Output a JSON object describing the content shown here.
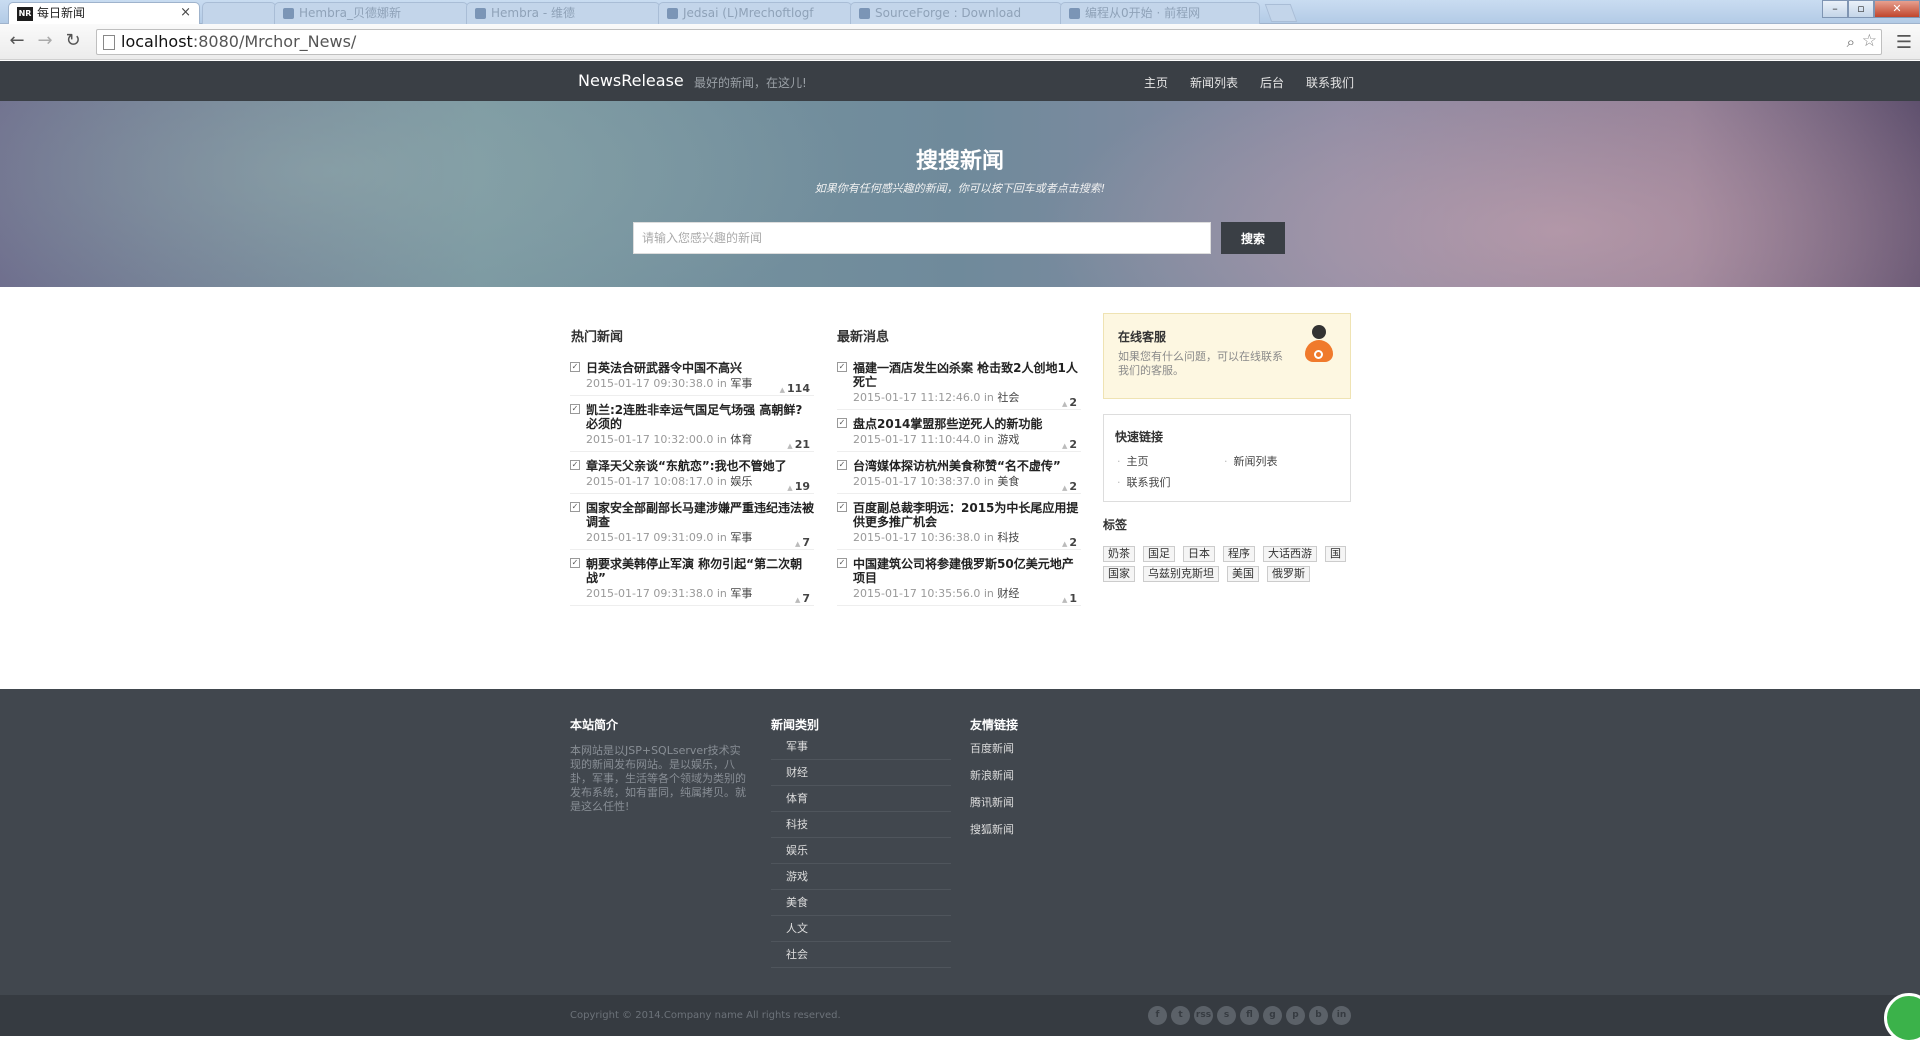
{
  "browser": {
    "active_tab": {
      "favicon": "NR",
      "title": "每日新闻"
    },
    "background_tabs": [
      "",
      "Hembra_贝德娜新",
      "Hembra - 维德",
      "Jedsai (L)Mrechoftlogf",
      "SourceForge : Download",
      "编程从0开始 · 前程网"
    ],
    "url_host": "localhost",
    "url_rest": ":8080/Mrchor_News/"
  },
  "nav": {
    "brand": "NewsRelease",
    "tagline": "最好的新闻，在这儿!",
    "links": [
      "主页",
      "新闻列表",
      "后台",
      "联系我们"
    ]
  },
  "hero": {
    "title": "搜搜新闻",
    "subtitle": "如果你有任何感兴趣的新闻，你可以按下回车或者点击搜索!",
    "search_placeholder": "请输入您感兴趣的新闻",
    "search_button": "搜索"
  },
  "hot": {
    "title": "热门新闻",
    "items": [
      {
        "title": "日英法合研武器令中国不高兴",
        "time": "2015-01-17 09:30:38.0",
        "in": "in",
        "category": "军事",
        "count": "114"
      },
      {
        "title": "凯兰:2连胜非幸运气国足气场强 高朝鲜?必须的",
        "time": "2015-01-17 10:32:00.0",
        "in": "in",
        "category": "体育",
        "count": "21"
      },
      {
        "title": "章泽天父亲谈“东航恋”:我也不管她了",
        "time": "2015-01-17 10:08:17.0",
        "in": "in",
        "category": "娱乐",
        "count": "19"
      },
      {
        "title": "国家安全部副部长马建涉嫌严重违纪违法被调查",
        "time": "2015-01-17 09:31:09.0",
        "in": "in",
        "category": "军事",
        "count": "7"
      },
      {
        "title": "朝要求美韩停止军演 称勿引起“第二次朝战”",
        "time": "2015-01-17 09:31:38.0",
        "in": "in",
        "category": "军事",
        "count": "7"
      }
    ]
  },
  "latest": {
    "title": "最新消息",
    "items": [
      {
        "title": "福建一酒店发生凶杀案 枪击致2人创地1人死亡",
        "time": "2015-01-17 11:12:46.0",
        "in": "in",
        "category": "社会",
        "count": "2"
      },
      {
        "title": "盘点2014掌盟那些逆死人的新功能",
        "time": "2015-01-17 11:10:44.0",
        "in": "in",
        "category": "游戏",
        "count": "2"
      },
      {
        "title": "台湾媒体探访杭州美食称赞“名不虚传”",
        "time": "2015-01-17 10:38:37.0",
        "in": "in",
        "category": "美食",
        "count": "2"
      },
      {
        "title": "百度副总裁李明远：2015为中长尾应用提供更多推广机会",
        "time": "2015-01-17 10:36:38.0",
        "in": "in",
        "category": "科技",
        "count": "2"
      },
      {
        "title": "中国建筑公司将参建俄罗斯50亿美元地产项目",
        "time": "2015-01-17 10:35:56.0",
        "in": "in",
        "category": "财经",
        "count": "1"
      }
    ]
  },
  "sidebar": {
    "service_title": "在线客服",
    "service_desc": "如果您有什么问题，可以在线联系我们的客服。",
    "quick_title": "快速链接",
    "quick_links": [
      "主页",
      "新闻列表",
      "联系我们"
    ],
    "tags_title": "标签",
    "tags": [
      "奶茶",
      "国足",
      "日本",
      "程序",
      "大话西游",
      "国",
      "国家",
      "乌兹别克斯坦",
      "美国",
      "俄罗斯"
    ]
  },
  "footer": {
    "about_title": "本站简介",
    "about_text": "本网站是以JSP+SQLserver技术实现的新闻发布网站。是以娱乐，八卦，军事，生活等各个领域为类别的发布系统，如有雷同，纯属拷贝。就是这么任性!",
    "cats_title": "新闻类别",
    "categories": [
      "军事",
      "财经",
      "体育",
      "科技",
      "娱乐",
      "游戏",
      "美食",
      "人文",
      "社会"
    ],
    "friends_title": "友情链接",
    "friends": [
      "百度新闻",
      "新浪新闻",
      "腾讯新闻",
      "搜狐新闻"
    ],
    "copyright": "Copyright © 2014.Company name All rights reserved.",
    "social": [
      "f",
      "t",
      "rss",
      "s",
      "fl",
      "g",
      "p",
      "b",
      "in"
    ]
  }
}
